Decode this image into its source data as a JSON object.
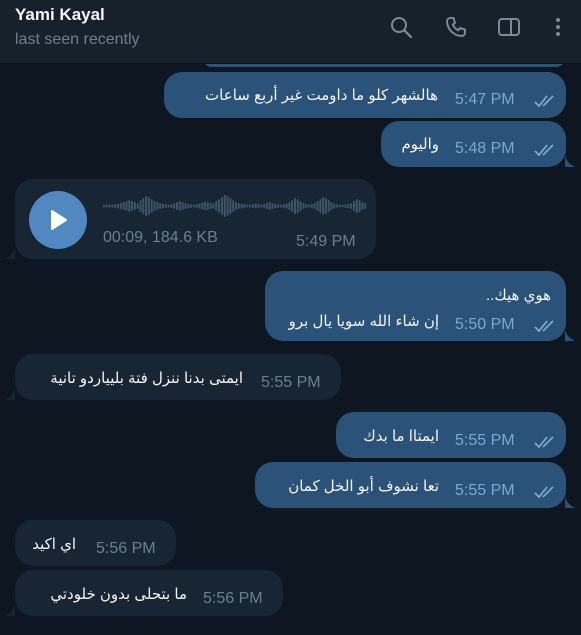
{
  "header": {
    "name": "Yami Kayal",
    "status": "last seen recently",
    "icons": [
      "search-icon",
      "phone-icon",
      "sidebar-toggle-icon",
      "more-vertical-icon"
    ]
  },
  "colors": {
    "background": "#0e1621",
    "header": "#17212b",
    "outgoing_bubble": "#2b5278",
    "incoming_bubble": "#182533",
    "accent": "#5288c1",
    "outgoing_time": "#7da8d3",
    "incoming_time": "#6d7f8f"
  },
  "messages": [
    {
      "direction": "out",
      "text": "هالشهر كلو ما داومت غير أربع ساعات",
      "time": "5:47 PM",
      "read": true
    },
    {
      "direction": "out",
      "text": "واليوم",
      "time": "5:48 PM",
      "read": true
    },
    {
      "direction": "in",
      "type": "voice",
      "duration": "00:09, 184.6 KB",
      "time": "5:49 PM"
    },
    {
      "direction": "out",
      "line1": "هوي هيك..",
      "line2": "إن شاء الله سويا يال برو",
      "time": "5:50 PM",
      "read": true
    },
    {
      "direction": "in",
      "text": "ايمتى بدنا ننزل فتة بليياردو تانية",
      "time": "5:55 PM"
    },
    {
      "direction": "out",
      "text": "ايمتاا ما بدك",
      "time": "5:55 PM",
      "read": true
    },
    {
      "direction": "out",
      "text": "تعا نشوف أبو الخل كمان",
      "time": "5:55 PM",
      "read": true
    },
    {
      "direction": "in",
      "text": "اي اكيد",
      "time": "5:56 PM"
    },
    {
      "direction": "in",
      "text": "ما بتحلى بدون خلودتي",
      "time": "5:56 PM"
    }
  ]
}
